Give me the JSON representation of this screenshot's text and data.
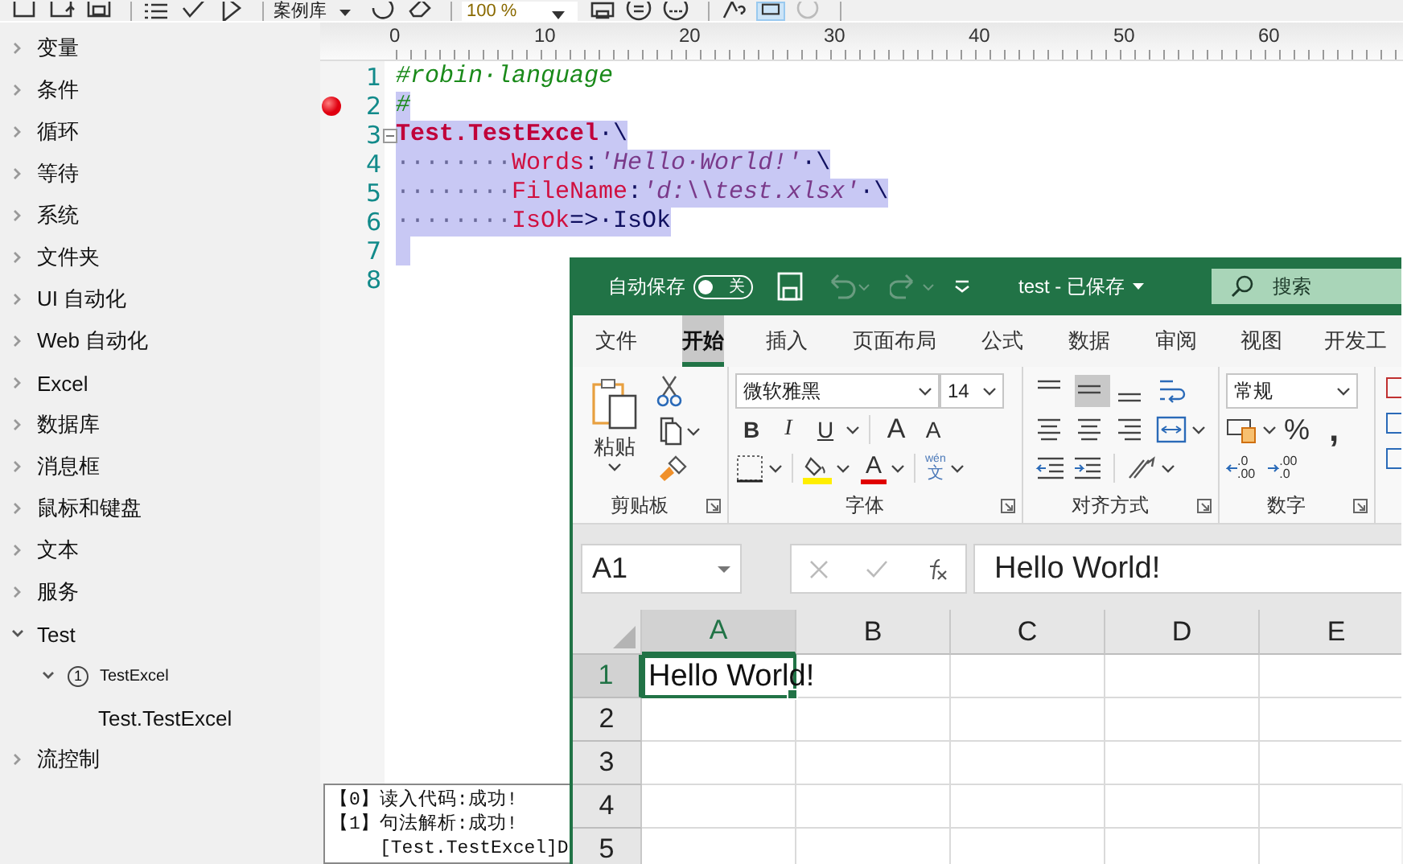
{
  "toolbar": {
    "library_label": "案例库",
    "zoom": "100 %"
  },
  "sidebar": {
    "items": [
      {
        "label": "变量",
        "expanded": false
      },
      {
        "label": "条件",
        "expanded": false
      },
      {
        "label": "循环",
        "expanded": false
      },
      {
        "label": "等待",
        "expanded": false
      },
      {
        "label": "系统",
        "expanded": false
      },
      {
        "label": "文件夹",
        "expanded": false
      },
      {
        "label": "UI 自动化",
        "expanded": false
      },
      {
        "label": "Web 自动化",
        "expanded": false
      },
      {
        "label": "Excel",
        "expanded": false
      },
      {
        "label": "数据库",
        "expanded": false
      },
      {
        "label": "消息框",
        "expanded": false
      },
      {
        "label": "鼠标和键盘",
        "expanded": false
      },
      {
        "label": "文本",
        "expanded": false
      },
      {
        "label": "服务",
        "expanded": false
      },
      {
        "label": "Test",
        "expanded": true,
        "children": [
          {
            "label": "TestExcel",
            "badge": "1",
            "expanded": true,
            "children": [
              {
                "label": "Test.TestExcel"
              }
            ]
          }
        ]
      },
      {
        "label": "流控制",
        "expanded": false
      }
    ]
  },
  "editor": {
    "ruler": [
      "0",
      "10",
      "20",
      "30",
      "40",
      "50",
      "60"
    ],
    "lines": [
      {
        "number": "1",
        "breakpoint": false,
        "fold": false,
        "selected": false,
        "tokens": [
          {
            "kind": "comment",
            "text": "#robin·language"
          }
        ]
      },
      {
        "number": "2",
        "breakpoint": true,
        "fold": false,
        "selected": true,
        "tokens": [
          {
            "kind": "comment",
            "text": "#"
          }
        ]
      },
      {
        "number": "3",
        "breakpoint": false,
        "fold": true,
        "selected": true,
        "tokens": [
          {
            "kind": "keyword",
            "text": "Test.TestExcel"
          },
          {
            "kind": "plain",
            "text": "·\\"
          }
        ]
      },
      {
        "number": "4",
        "breakpoint": false,
        "fold": false,
        "selected": true,
        "tokens": [
          {
            "kind": "space",
            "text": "········"
          },
          {
            "kind": "param",
            "text": "Words"
          },
          {
            "kind": "plain",
            "text": ":"
          },
          {
            "kind": "string",
            "text": "'Hello·World!'"
          },
          {
            "kind": "plain",
            "text": "·\\"
          }
        ]
      },
      {
        "number": "5",
        "breakpoint": false,
        "fold": false,
        "selected": true,
        "tokens": [
          {
            "kind": "space",
            "text": "········"
          },
          {
            "kind": "param",
            "text": "FileName"
          },
          {
            "kind": "plain",
            "text": ":"
          },
          {
            "kind": "string",
            "text": "'d:\\\\test.xlsx'"
          },
          {
            "kind": "plain",
            "text": "·\\"
          }
        ]
      },
      {
        "number": "6",
        "breakpoint": false,
        "fold": false,
        "selected": true,
        "tokens": [
          {
            "kind": "space",
            "text": "········"
          },
          {
            "kind": "param",
            "text": "IsOk"
          },
          {
            "kind": "plain",
            "text": "=>·IsOk"
          }
        ]
      },
      {
        "number": "7",
        "breakpoint": false,
        "fold": false,
        "selected": true
      },
      {
        "number": "8",
        "breakpoint": false,
        "fold": false,
        "selected": false
      }
    ]
  },
  "output": {
    "lines": [
      {
        "kind": "status",
        "text": "【0】读入代码:成功!"
      },
      {
        "kind": "status",
        "text": "【1】句法解析:成功!"
      },
      {
        "kind": "detail",
        "text": "[Test.TestExcel]D"
      }
    ]
  },
  "excel": {
    "autosave_label": "自动保存",
    "autosave_on": false,
    "autosave_state": "关",
    "document_title": "test - 已保存",
    "search_placeholder": "搜索",
    "tabs": [
      {
        "label": "文件",
        "selected": false
      },
      {
        "label": "开始",
        "selected": true
      },
      {
        "label": "插入",
        "selected": false
      },
      {
        "label": "页面布局",
        "selected": false
      },
      {
        "label": "公式",
        "selected": false
      },
      {
        "label": "数据",
        "selected": false
      },
      {
        "label": "审阅",
        "selected": false
      },
      {
        "label": "视图",
        "selected": false
      },
      {
        "label": "开发工",
        "selected": false
      }
    ],
    "ribbon": {
      "clipboard": {
        "label": "剪贴板",
        "paste": "粘贴"
      },
      "font": {
        "label": "字体",
        "font_name": "微软雅黑",
        "font_size": "14",
        "style_buttons": [
          "B",
          "I",
          "U"
        ],
        "size_buttons": [
          "A",
          "A"
        ],
        "font_color": "A",
        "phonetic_top": "wén",
        "phonetic_bottom": "文"
      },
      "alignment": {
        "label": "对齐方式",
        "vertical_buttons": [
          {
            "selected": false
          },
          {
            "selected": true
          },
          {
            "selected": false
          }
        ]
      },
      "number": {
        "label": "数字",
        "format": "常规",
        "percent": "%",
        "comma": ",",
        "decimal_buttons": [
          {
            "top": ".0",
            "bottom": ".00"
          },
          {
            "top": ".00",
            "bottom": ".0"
          }
        ]
      }
    },
    "name_box": "A1",
    "formula": "Hello World!",
    "columns": [
      {
        "label": "A",
        "selected": true
      },
      {
        "label": "B",
        "selected": false
      },
      {
        "label": "C",
        "selected": false
      },
      {
        "label": "D",
        "selected": false
      },
      {
        "label": "E",
        "selected": false
      }
    ],
    "rows": [
      {
        "label": "1",
        "selected": true,
        "cells": [
          "Hello World!"
        ]
      },
      {
        "label": "2",
        "selected": false
      },
      {
        "label": "3",
        "selected": false
      },
      {
        "label": "4",
        "selected": false
      },
      {
        "label": "5",
        "selected": false
      }
    ]
  }
}
